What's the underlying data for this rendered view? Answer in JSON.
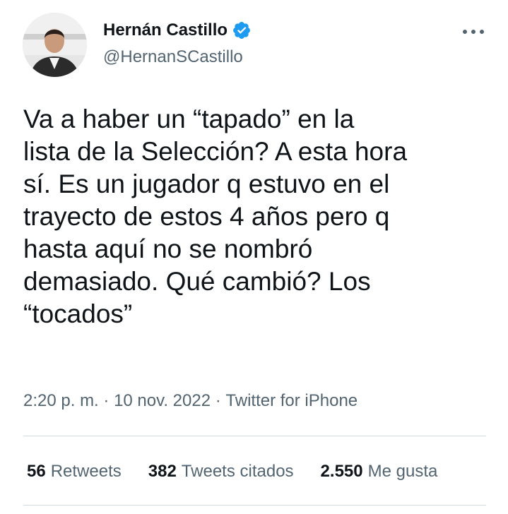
{
  "author": {
    "name": "Hernán Castillo",
    "handle": "@HernanSCastillo",
    "verified_color": "#1d9bf0"
  },
  "tweet": {
    "text": "Va a haber un “tapado” en la\nlista de la Selección? A esta hora\nsí. Es un jugador q estuvo en el\ntrayecto de estos 4 años pero q\nhasta aquí no se nombró\ndemasiado. Qué cambió? Los\n“tocados”"
  },
  "meta": {
    "time": "2:20 p. m.",
    "separator": " · ",
    "date": "10 nov. 2022",
    "source": "Twitter for iPhone"
  },
  "stats": {
    "retweets_count": "56",
    "retweets_label": "Retweets",
    "quotes_count": "382",
    "quotes_label": "Tweets citados",
    "likes_count": "2.550",
    "likes_label": "Me gusta"
  },
  "icons": {
    "more": "more-horizontal-icon",
    "verified": "verified-badge-icon"
  }
}
